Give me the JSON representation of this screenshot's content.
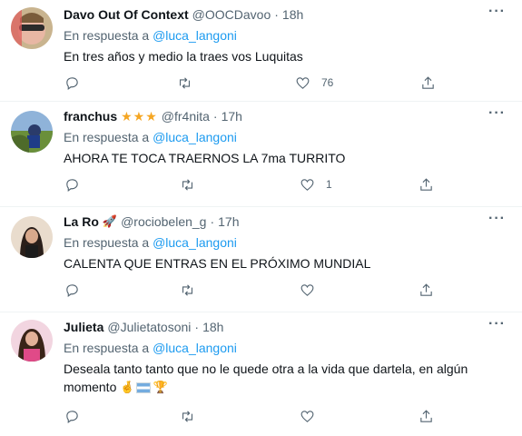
{
  "tweets": [
    {
      "name": "Davo Out Of Context",
      "badge": "",
      "handle": "@OOCDavoo",
      "dot": "·",
      "time": "18h",
      "reply_prefix": "En respuesta a",
      "reply_to": "@luca_langoni",
      "text": "En tres años y medio la traes vos Luquitas",
      "likes": "76",
      "avatar": "avatar-sunglasses"
    },
    {
      "name": "franchus",
      "badge": "★★★",
      "handle": "@fr4nita",
      "dot": "·",
      "time": "17h",
      "reply_prefix": "En respuesta a",
      "reply_to": "@luca_langoni",
      "text": "AHORA TE TOCA TRAERNOS LA 7ma TURRITO",
      "likes": "1",
      "avatar": "avatar-landscape"
    },
    {
      "name": "La Ro",
      "badge": "🚀",
      "handle": "@rociobelen_g",
      "dot": "·",
      "time": "17h",
      "reply_prefix": "En respuesta a",
      "reply_to": "@luca_langoni",
      "text": "CALENTA QUE ENTRAS EN EL PRÓXIMO MUNDIAL",
      "likes": "",
      "avatar": "avatar-woman-dark"
    },
    {
      "name": "Julieta",
      "badge": "",
      "handle": "@Julietatosoni",
      "dot": "·",
      "time": "18h",
      "reply_prefix": "En respuesta a",
      "reply_to": "@luca_langoni",
      "text": "Desealа tanto tanto que no le quede otra a la vida que dartela, en algún momento",
      "text_emoji_trail": "🤞🏆",
      "likes": "",
      "avatar": "avatar-woman-pink"
    }
  ],
  "icons": {
    "reply": "reply-icon",
    "retweet": "retweet-icon",
    "like": "heart-icon",
    "share": "share-icon",
    "more": "more-icon"
  },
  "colors": {
    "link": "#1d9bf0",
    "muted": "#536471",
    "text": "#0f1419",
    "star": "#f5a623"
  }
}
